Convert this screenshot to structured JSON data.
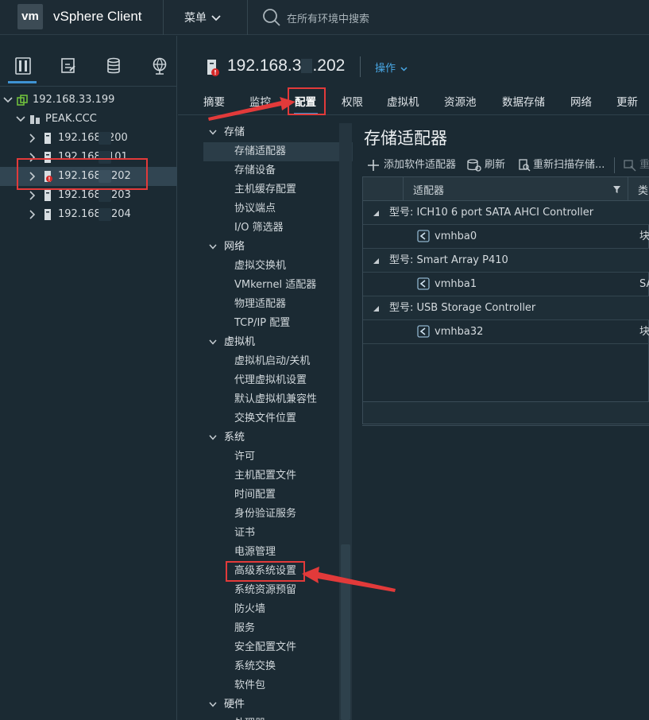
{
  "header": {
    "logo_text": "vm",
    "app_title": "vSphere Client",
    "menu_label": "菜单",
    "search_placeholder": "在所有环境中搜索"
  },
  "tree": [
    {
      "label": "192.168.33.199",
      "depth": 0,
      "expanded": true,
      "icon": "datacenter-icon"
    },
    {
      "label": "PEAK.CCC",
      "depth": 1,
      "expanded": true,
      "icon": "cluster-icon"
    },
    {
      "label_prefix": "192.168.",
      "label_suffix": "200",
      "depth": 2,
      "icon": "host-icon"
    },
    {
      "label_prefix": "192.168.",
      "label_suffix": "101",
      "depth": 2,
      "icon": "host-icon"
    },
    {
      "label_prefix": "192.168.",
      "label_suffix": "202",
      "depth": 2,
      "icon": "host-alert-icon",
      "selected": true
    },
    {
      "label_prefix": "192.168.",
      "label_suffix": "203",
      "depth": 2,
      "icon": "host-icon"
    },
    {
      "label_prefix": "192.168.",
      "label_suffix": "204",
      "depth": 2,
      "icon": "host-icon"
    }
  ],
  "main": {
    "host_title_prefix": "192.168.3",
    "host_title_suffix": ".202",
    "actions_label": "操作",
    "tabs": [
      {
        "label": "摘要"
      },
      {
        "label": "监控"
      },
      {
        "label": "配置",
        "active": true
      },
      {
        "label": "权限"
      },
      {
        "label": "虚拟机"
      },
      {
        "label": "资源池"
      },
      {
        "label": "数据存储"
      },
      {
        "label": "网络"
      },
      {
        "label": "更新"
      }
    ]
  },
  "config_menu": [
    {
      "label": "存储",
      "group": true
    },
    {
      "label": "存储适配器",
      "selected": true
    },
    {
      "label": "存储设备"
    },
    {
      "label": "主机缓存配置"
    },
    {
      "label": "协议端点"
    },
    {
      "label": "I/O 筛选器"
    },
    {
      "label": "网络",
      "group": true
    },
    {
      "label": "虚拟交换机"
    },
    {
      "label": "VMkernel 适配器"
    },
    {
      "label": "物理适配器"
    },
    {
      "label": "TCP/IP 配置"
    },
    {
      "label": "虚拟机",
      "group": true
    },
    {
      "label": "虚拟机启动/关机"
    },
    {
      "label": "代理虚拟机设置"
    },
    {
      "label": "默认虚拟机兼容性"
    },
    {
      "label": "交换文件位置"
    },
    {
      "label": "系统",
      "group": true
    },
    {
      "label": "许可"
    },
    {
      "label": "主机配置文件"
    },
    {
      "label": "时间配置"
    },
    {
      "label": "身份验证服务"
    },
    {
      "label": "证书"
    },
    {
      "label": "电源管理"
    },
    {
      "label": "高级系统设置",
      "highlighted": true
    },
    {
      "label": "系统资源预留"
    },
    {
      "label": "防火墙"
    },
    {
      "label": "服务"
    },
    {
      "label": "安全配置文件"
    },
    {
      "label": "系统交换"
    },
    {
      "label": "软件包"
    },
    {
      "label": "硬件",
      "group": true
    },
    {
      "label": "处理器"
    }
  ],
  "content": {
    "title": "存储适配器",
    "toolbar": {
      "add_label": "添加软件适配器",
      "refresh_label": "刷新",
      "rescan_label": "重新扫描存储...",
      "more_label": "重"
    },
    "grid": {
      "col_adapter": "适配器",
      "col_type": "类",
      "rows": [
        {
          "kind": "group",
          "label": "型号: ICH10 6 port SATA AHCI Controller"
        },
        {
          "kind": "item",
          "label": "vmhba0",
          "type": "块"
        },
        {
          "kind": "group",
          "label": "型号: Smart Array P410"
        },
        {
          "kind": "item",
          "label": "vmhba1",
          "type": "SA"
        },
        {
          "kind": "group",
          "label": "型号: USB Storage Controller"
        },
        {
          "kind": "item",
          "label": "vmhba32",
          "type": "块"
        }
      ]
    }
  },
  "colors": {
    "accent": "#3f93d3",
    "link": "#49a8e6",
    "annotation_red": "#e23a3a",
    "alert_red": "#d62828",
    "background": "#1b2a33"
  }
}
